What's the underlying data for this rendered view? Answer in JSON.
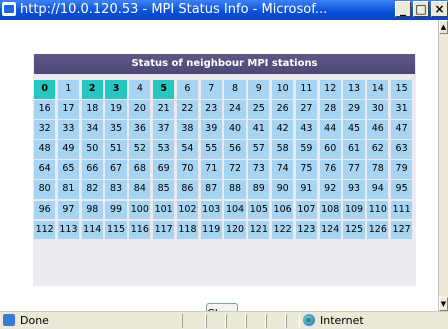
{
  "window": {
    "title": "http://10.0.120.53 - MPI Status Info - Microsof...",
    "minimize_label": "_",
    "maximize_label": "□",
    "close_label": "×"
  },
  "panel": {
    "title": "Status of neighbour MPI stations",
    "active_stations": [
      "0",
      "2",
      "3",
      "5"
    ],
    "stations": [
      "0",
      "1",
      "2",
      "3",
      "4",
      "5",
      "6",
      "7",
      "8",
      "9",
      "10",
      "11",
      "12",
      "13",
      "14",
      "15",
      "16",
      "17",
      "18",
      "19",
      "20",
      "21",
      "22",
      "23",
      "24",
      "25",
      "26",
      "27",
      "28",
      "29",
      "30",
      "31",
      "32",
      "33",
      "34",
      "35",
      "36",
      "37",
      "38",
      "39",
      "40",
      "41",
      "42",
      "43",
      "44",
      "45",
      "46",
      "47",
      "48",
      "49",
      "50",
      "51",
      "52",
      "53",
      "54",
      "55",
      "56",
      "57",
      "58",
      "59",
      "60",
      "61",
      "62",
      "63",
      "64",
      "65",
      "66",
      "67",
      "68",
      "69",
      "70",
      "71",
      "72",
      "73",
      "74",
      "75",
      "76",
      "77",
      "78",
      "79",
      "80",
      "81",
      "82",
      "83",
      "84",
      "85",
      "86",
      "87",
      "88",
      "89",
      "90",
      "91",
      "92",
      "93",
      "94",
      "95",
      "96",
      "97",
      "98",
      "99",
      "100",
      "101",
      "102",
      "103",
      "104",
      "105",
      "106",
      "107",
      "108",
      "109",
      "110",
      "111",
      "112",
      "113",
      "114",
      "115",
      "116",
      "117",
      "118",
      "119",
      "120",
      "121",
      "122",
      "123",
      "124",
      "125",
      "126",
      "127"
    ]
  },
  "close_button": {
    "label": "Close"
  },
  "statusbar": {
    "status": "Done",
    "zone": "Internet"
  },
  "colors": {
    "cell": "#a6d4f2",
    "active_cell": "#27c6c0",
    "panel_header": "#54537f"
  }
}
